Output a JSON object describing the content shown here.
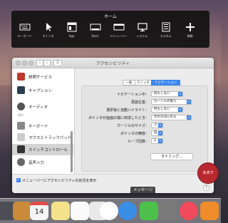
{
  "home_panel": {
    "title": "ホーム",
    "buttons": [
      {
        "label": "キーボード",
        "icon": "keyboard-icon"
      },
      {
        "label": "ポインタ",
        "icon": "pointer-icon"
      },
      {
        "label": "App",
        "icon": "app-window-icon"
      },
      {
        "label": "Dock",
        "icon": "dock-icon"
      },
      {
        "label": "メニューバー",
        "icon": "menubar-icon"
      },
      {
        "label": "システム",
        "icon": "monitor-icon"
      },
      {
        "label": "カスタム",
        "icon": "list-icon"
      },
      {
        "label": "移動",
        "icon": "move-arrows-icon"
      }
    ]
  },
  "window": {
    "title": "アクセシビリティ",
    "sidebar": {
      "items": [
        {
          "label": "説明サービス",
          "icon": "speech-bubble-icon",
          "color": "#c0392b"
        },
        {
          "label": "キャプション",
          "icon": "caption-icon",
          "color": "#2c3e50"
        },
        {
          "label": "オーディオ",
          "icon": "speaker-icon",
          "color": "#555555"
        },
        {
          "label": "キーボード",
          "icon": "keyboard-icon",
          "color": "#888888"
        },
        {
          "label": "マウスとトラックパッド",
          "icon": "mouse-icon",
          "color": "#aaaaaa"
        },
        {
          "label": "スイッチコントロール",
          "icon": "switch-control-icon",
          "color": "#333333"
        },
        {
          "label": "音声入力",
          "icon": "microphone-icon",
          "color": "#666666"
        }
      ],
      "section_label": "操作"
    },
    "tabs": [
      "一般",
      "スイッチ",
      "ナビゲーション"
    ],
    "active_tab": "ナビゲーション",
    "settings": [
      {
        "label": "ナビゲーション中：",
        "value": "何もしない"
      },
      {
        "label": "再開位置：",
        "value": "カーソルの後ろ"
      },
      {
        "label": "選択後に自動ハイライト：",
        "value": "何もしない"
      },
      {
        "label": "ポインタが画面の端に到達したとき：",
        "value": "元の方向に戻る"
      },
      {
        "label": "カーソルのサイズ：",
        "value": "小"
      },
      {
        "label": "ポインタの精度：",
        "value": "低"
      },
      {
        "label": "ループ回数：",
        "value": "2"
      }
    ],
    "timing_button": "タイミング...",
    "checkbox_label": "メニューバーにアクセシビリティの状況を表示",
    "help_label": "?"
  },
  "tooltip": "メッセージ",
  "badge_text": "あ済ヲ",
  "dock": {
    "icons": [
      {
        "icon": "app-icon-1",
        "color": "#4d4d55"
      },
      {
        "icon": "books-icon",
        "color": "#c98a3a"
      },
      {
        "icon": "calendar-icon",
        "color": "#f5f5f5",
        "label": "14"
      },
      {
        "icon": "notes-icon",
        "color": "#f4e28a"
      },
      {
        "icon": "reminders-icon",
        "color": "#fafafa"
      },
      {
        "icon": "dots-icon",
        "color": "#e9e9e9"
      },
      {
        "icon": "photos-icon",
        "color": "#fefefe"
      },
      {
        "icon": "messages-icon",
        "color": "#3a8ee6"
      },
      {
        "icon": "facetime-icon",
        "color": "#4cc04a"
      },
      {
        "icon": "photo-booth-icon",
        "color": "#7a7a7a"
      },
      {
        "icon": "music-icon",
        "color": "#f04a5c"
      },
      {
        "icon": "ibooks-icon",
        "color": "#f08c2a"
      }
    ]
  }
}
